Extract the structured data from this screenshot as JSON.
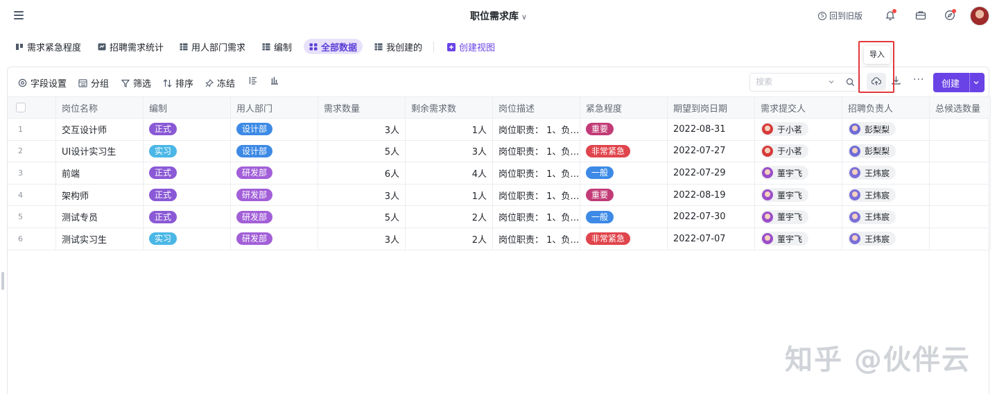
{
  "app": {
    "title": "职位需求库",
    "old_version_label": "回到旧版",
    "colors": {
      "accent": "#6a43e6",
      "danger": "#f54a45",
      "highlight": "#e2373c"
    }
  },
  "views": [
    {
      "label": "需求紧急程度",
      "icon": "kanban-icon",
      "active": false
    },
    {
      "label": "招聘需求统计",
      "icon": "chart-icon",
      "active": false
    },
    {
      "label": "用人部门需求",
      "icon": "grid-icon",
      "active": false
    },
    {
      "label": "编制",
      "icon": "grid-icon",
      "active": false
    },
    {
      "label": "全部数据",
      "icon": "gallery-icon",
      "active": true
    },
    {
      "label": "我创建的",
      "icon": "grid-icon",
      "active": false
    },
    {
      "label": "创建视图",
      "icon": "plus-icon",
      "active": false
    }
  ],
  "toolbar": {
    "field_settings": "字段设置",
    "group": "分组",
    "filter": "筛选",
    "sort": "排序",
    "freeze": "冻结",
    "search_placeholder": "搜索",
    "import_tooltip": "导入",
    "more": "···",
    "create": "创建"
  },
  "table": {
    "columns": [
      "岗位名称",
      "编制",
      "用人部门",
      "需求数量",
      "剩余需求数",
      "岗位描述",
      "紧急程度",
      "期望到岗日期",
      "需求提交人",
      "招聘负责人",
      "总候选数量"
    ],
    "rows": [
      {
        "idx": "1",
        "name": "交互设计师",
        "type": "正式",
        "dept": "设计部",
        "demand": "3人",
        "remaining": "1人",
        "desc": "岗位职责：  1、负…",
        "urgency": "重要",
        "date": "2022-08-31",
        "submitter": "于小茗",
        "recruiter": "彭梨梨",
        "candidates": ""
      },
      {
        "idx": "2",
        "name": "UI设计实习生",
        "type": "实习",
        "dept": "设计部",
        "demand": "5人",
        "remaining": "3人",
        "desc": "岗位职责：  1、负…",
        "urgency": "非常紧急",
        "date": "2022-07-27",
        "submitter": "于小茗",
        "recruiter": "彭梨梨",
        "candidates": ""
      },
      {
        "idx": "3",
        "name": "前端",
        "type": "正式",
        "dept": "研发部",
        "demand": "6人",
        "remaining": "4人",
        "desc": "岗位职责：  1、负…",
        "urgency": "一般",
        "date": "2022-07-29",
        "submitter": "董宇飞",
        "recruiter": "王炜宸",
        "candidates": ""
      },
      {
        "idx": "4",
        "name": "架构师",
        "type": "正式",
        "dept": "研发部",
        "demand": "3人",
        "remaining": "1人",
        "desc": "岗位职责：  1、负…",
        "urgency": "重要",
        "date": "2022-08-19",
        "submitter": "董宇飞",
        "recruiter": "王炜宸",
        "candidates": ""
      },
      {
        "idx": "5",
        "name": "测试专员",
        "type": "正式",
        "dept": "研发部",
        "demand": "5人",
        "remaining": "2人",
        "desc": "岗位职责：  1、负…",
        "urgency": "一般",
        "date": "2022-07-30",
        "submitter": "董宇飞",
        "recruiter": "王炜宸",
        "candidates": ""
      },
      {
        "idx": "6",
        "name": "测试实习生",
        "type": "实习",
        "dept": "研发部",
        "demand": "3人",
        "remaining": "2人",
        "desc": "岗位职责：  1、负…",
        "urgency": "非常紧急",
        "date": "2022-07-07",
        "submitter": "董宇飞",
        "recruiter": "王炜宸",
        "candidates": ""
      }
    ],
    "tag_colors": {
      "正式": "#8a59d6",
      "实习": "#4ab7e6",
      "设计部": "#3d8ae6",
      "研发部": "#a25fd8",
      "重要": "#c23b77",
      "非常紧急": "#e0444c",
      "一般": "#3d8ae6"
    },
    "avatar_colors": {
      "于小茗": "#d63a3a",
      "董宇飞": "#9a4ec9",
      "彭梨梨": "#6f6bd6",
      "王炜宸": "#7b6fd9"
    }
  },
  "watermark": "知乎 @伙伴云"
}
